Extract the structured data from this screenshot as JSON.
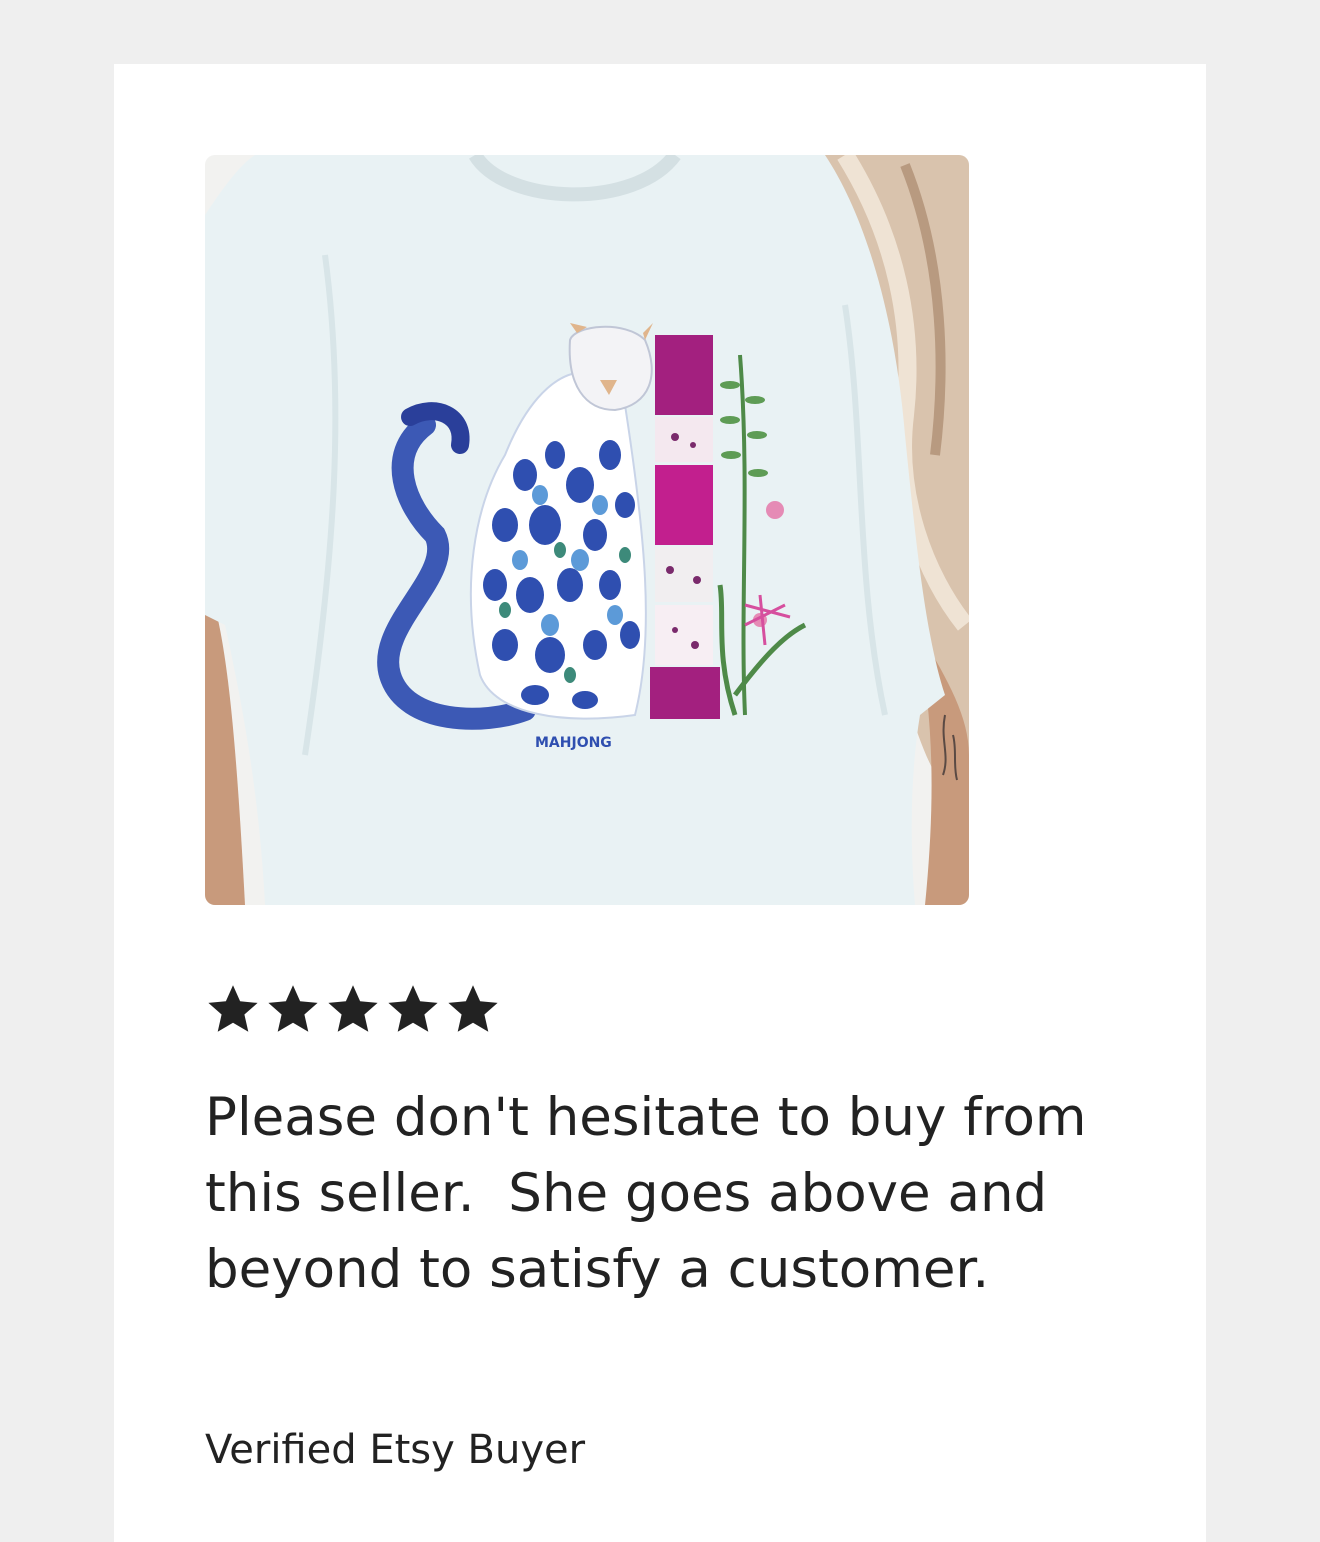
{
  "review": {
    "rating": 5,
    "rating_max": 5,
    "star_icon": "star-icon",
    "star_color": "#222222",
    "text": "Please don't hesitate to buy from this seller.  She goes above and beyond to satisfy a customer.",
    "reviewer": "Verified Etsy Buyer"
  },
  "product_image": {
    "shirt_print_text": "MAHJONG"
  },
  "colors": {
    "page_background": "#efefef",
    "card_background": "#ffffff",
    "text": "#222222"
  }
}
